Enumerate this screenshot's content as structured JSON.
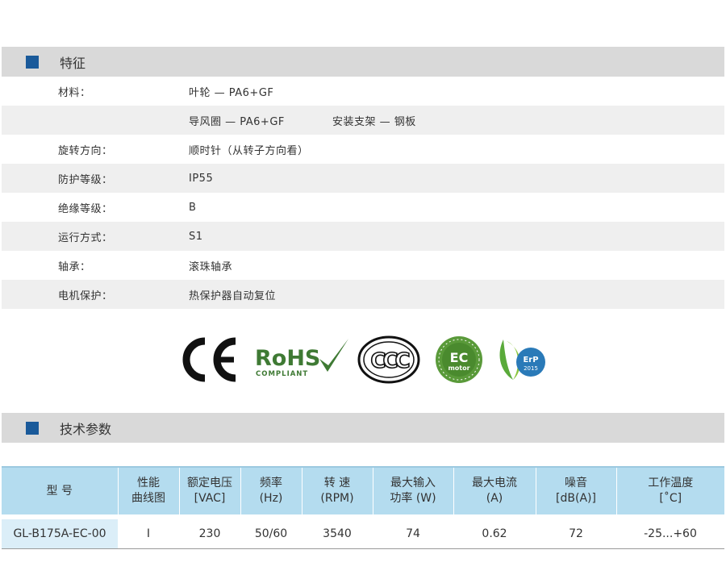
{
  "sections": {
    "features_title": "特征",
    "tech_title": "技术参数"
  },
  "features": [
    {
      "label": "材料：",
      "value": "叶轮 — PA6+GF",
      "value2": ""
    },
    {
      "label": "",
      "value": "导风圈 — PA6+GF",
      "value2": "安装支架 — 钢板"
    },
    {
      "label": "旋转方向：",
      "value": "顺时针（从转子方向看）",
      "value2": ""
    },
    {
      "label": "防护等级：",
      "value": "IP55",
      "value2": ""
    },
    {
      "label": "绝缘等级：",
      "value": "B",
      "value2": ""
    },
    {
      "label": "运行方式：",
      "value": "S1",
      "value2": ""
    },
    {
      "label": "轴承：",
      "value": "滚珠轴承",
      "value2": ""
    },
    {
      "label": "电机保护：",
      "value": "热保护器自动复位",
      "value2": ""
    }
  ],
  "logos": {
    "ce": "CE",
    "rohs_main": "RoHS",
    "rohs_sub": "COMPLIANT",
    "ccc": "CCC",
    "ec_main": "EC",
    "ec_sub": "motor",
    "erp_main": "ErP",
    "erp_sub": "2015"
  },
  "table": {
    "headers": [
      [
        "型 号",
        ""
      ],
      [
        "性能",
        "曲线图"
      ],
      [
        "额定电压",
        "[VAC]"
      ],
      [
        "频率",
        "(Hz)"
      ],
      [
        "转 速",
        "(RPM)"
      ],
      [
        "最大输入",
        "功率 (W)"
      ],
      [
        "最大电流",
        "(A)"
      ],
      [
        "噪音",
        "[dB(A)]"
      ],
      [
        "工作温度",
        "[˚C]"
      ]
    ],
    "rows": [
      [
        "GL-B175A-EC-00",
        "I",
        "230",
        "50/60",
        "3540",
        "74",
        "0.62",
        "72",
        "-25...+60"
      ]
    ]
  },
  "colors": {
    "section_square": "#1a5a9a",
    "header_bg": "#b4dcef",
    "model_cell_bg": "#dbeef8",
    "rohs_green": "#3f7a34",
    "ec_green": "#5a9a3a",
    "erp_blue": "#2a7ab8"
  }
}
